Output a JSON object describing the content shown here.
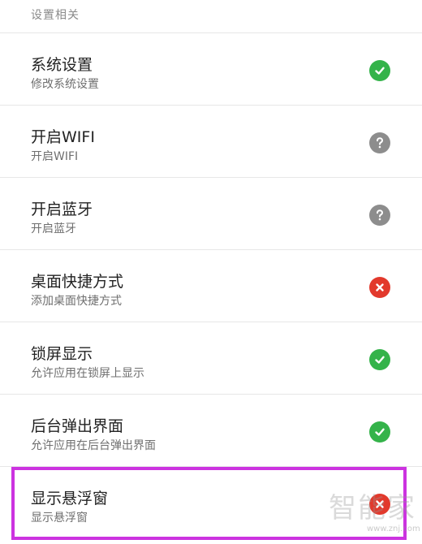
{
  "section": {
    "title": "设置相关"
  },
  "items": [
    {
      "title": "系统设置",
      "subtitle": "修改系统设置",
      "status": "granted",
      "icon": "check-circle-icon"
    },
    {
      "title": "开启WIFI",
      "subtitle": "开启WIFI",
      "status": "unknown",
      "icon": "question-circle-icon"
    },
    {
      "title": "开启蓝牙",
      "subtitle": "开启蓝牙",
      "status": "unknown",
      "icon": "question-circle-icon"
    },
    {
      "title": "桌面快捷方式",
      "subtitle": "添加桌面快捷方式",
      "status": "denied",
      "icon": "x-circle-icon"
    },
    {
      "title": "锁屏显示",
      "subtitle": "允许应用在锁屏上显示",
      "status": "granted",
      "icon": "check-circle-icon"
    },
    {
      "title": "后台弹出界面",
      "subtitle": "允许应用在后台弹出界面",
      "status": "granted",
      "icon": "check-circle-icon"
    },
    {
      "title": "显示悬浮窗",
      "subtitle": "显示悬浮窗",
      "status": "denied",
      "icon": "x-circle-icon"
    }
  ],
  "watermark": {
    "text": "智能家",
    "url": "www.znj.com"
  },
  "colors": {
    "granted": "#34b34a",
    "unknown": "#8d8d8d",
    "denied": "#e2392c",
    "highlight": "#cc33e0"
  }
}
